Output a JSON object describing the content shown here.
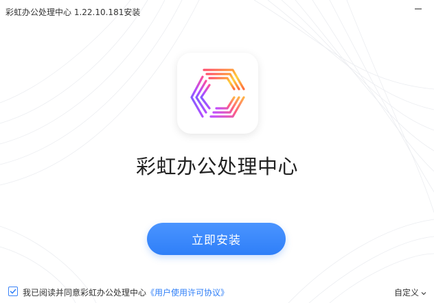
{
  "window": {
    "title": "彩虹办公处理中心 1.22.10.181安装"
  },
  "controls": {
    "minimize_icon": "minimize-icon"
  },
  "app": {
    "name": "彩虹办公处理中心",
    "logo": "rainbow-hexagon-logo"
  },
  "install": {
    "button_label": "立即安装"
  },
  "footer": {
    "agreement_checked": true,
    "agreement_text": "我已阅读并同意彩虹办公处理中心",
    "agreement_link": "《用户使用许可协议》",
    "custom_label": "自定义"
  },
  "colors": {
    "accent": "#2f7ff8",
    "text": "#333333"
  }
}
